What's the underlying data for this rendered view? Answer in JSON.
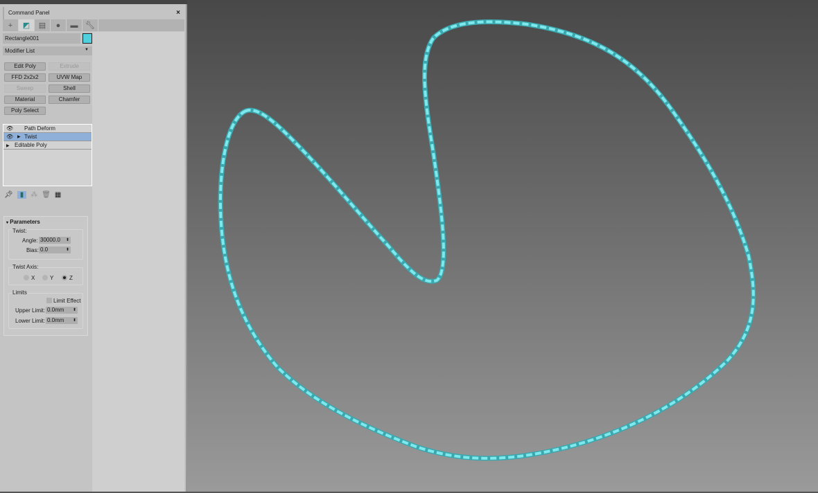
{
  "panel": {
    "title": "Command Panel",
    "close": "×",
    "tabs": [
      "create",
      "modify",
      "hierarchy",
      "motion",
      "display",
      "utilities"
    ],
    "object_name": "Rectangle001",
    "object_color": "#4fd0dc",
    "modifier_list": "Modifier List",
    "buttons": [
      {
        "label": "Edit Poly",
        "enabled": true
      },
      {
        "label": "Extrude",
        "enabled": false
      },
      {
        "label": "FFD 2x2x2",
        "enabled": true
      },
      {
        "label": "UVW Map",
        "enabled": true
      },
      {
        "label": "Sweep",
        "enabled": false
      },
      {
        "label": "Shell",
        "enabled": true
      },
      {
        "label": "Material",
        "enabled": true
      },
      {
        "label": "Chamfer",
        "enabled": true
      },
      {
        "label": "Poly Select",
        "enabled": true
      }
    ],
    "stack": [
      {
        "label": "Path Deform"
      },
      {
        "label": "Twist",
        "selected": true
      },
      {
        "label": "Editable Poly"
      }
    ],
    "parameters": {
      "title": "Parameters",
      "twist_group": "Twist:",
      "angle_label": "Angle:",
      "angle": "30000.0",
      "bias_label": "Bias:",
      "bias": "0.0",
      "axis_group": "Twist Axis:",
      "axes": [
        "X",
        "Y",
        "Z"
      ],
      "selected_axis": "Z",
      "limits_group": "Limits",
      "limit_effect": "Limit Effect",
      "upper_label": "Upper Limit:",
      "upper": "0.0mm",
      "lower_label": "Lower Limit:",
      "lower": "0.0mm"
    }
  },
  "viewport": {
    "object_color": "#52c8cc"
  }
}
